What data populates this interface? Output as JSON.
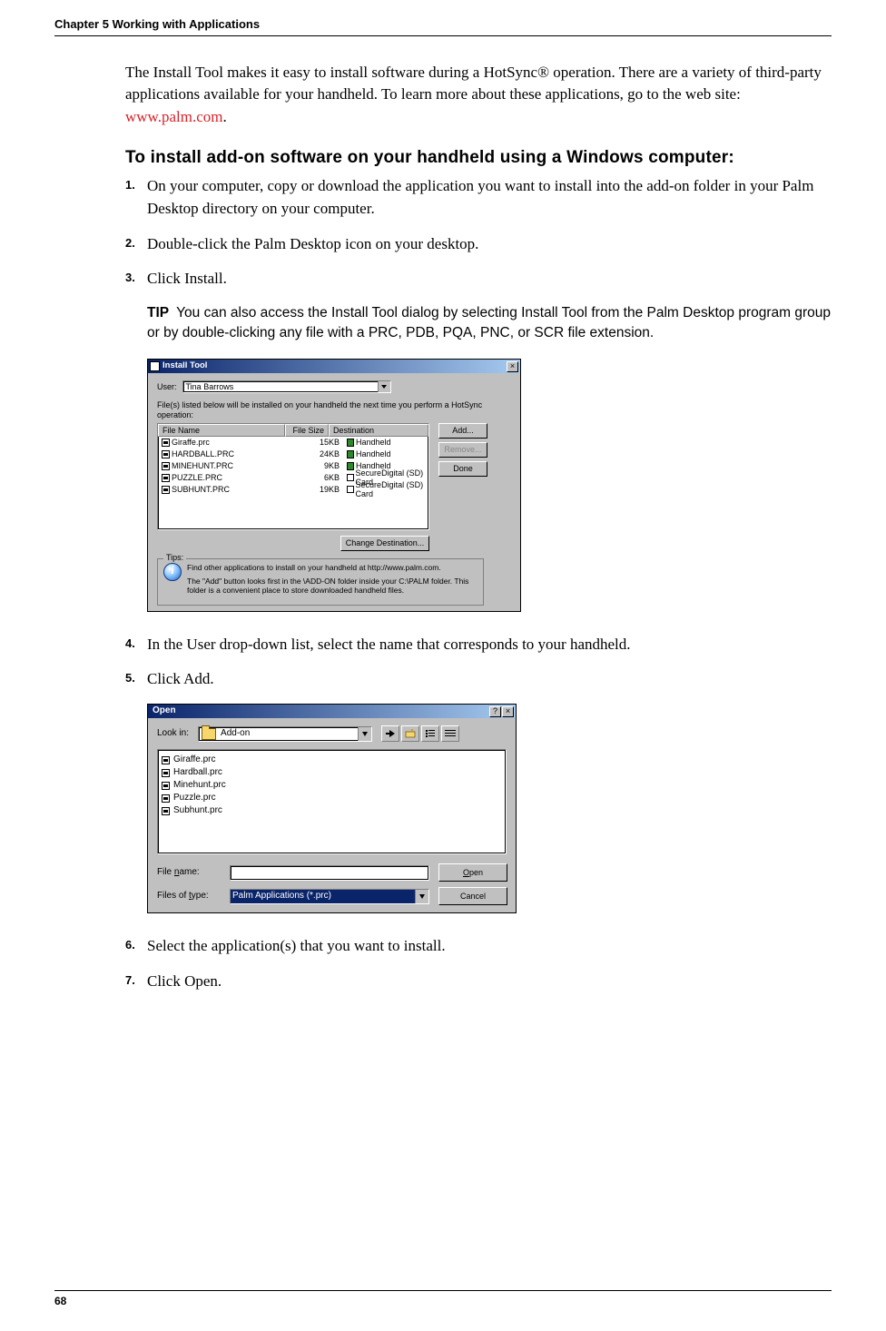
{
  "header": "Chapter 5    Working with Applications",
  "page_number": "68",
  "intro": {
    "text_before_link": "The Install Tool makes it easy to install software during a HotSync® operation. There are a variety of third-party applications available for your handheld. To learn more about these applications, go to the web site: ",
    "link": "www.palm.com",
    "text_after_link": "."
  },
  "heading": "To install add-on software on your handheld using a Windows computer:",
  "steps": {
    "s1": "On your computer, copy or download the application you want to install into the add-on folder in your Palm Desktop directory on your computer.",
    "s2": "Double-click the Palm Desktop icon on your desktop.",
    "s3": "Click Install.",
    "s4": "In the User drop-down list, select the name that corresponds to your handheld.",
    "s5": "Click Add.",
    "s6": "Select the application(s) that you want to install.",
    "s7": "Click Open."
  },
  "tip": {
    "label": "TIP",
    "text": "You can also access the Install Tool dialog by selecting Install Tool from the Palm Desktop program group or by double-clicking any file with a PRC, PDB, PQA, PNC, or SCR file extension."
  },
  "install_dialog": {
    "title": "Install Tool",
    "user_label": "User:",
    "user_value": "Tina Barrows",
    "desc": "File(s) listed below will be installed on your handheld the next time you perform a HotSync operation:",
    "columns": {
      "name": "File Name",
      "size": "File Size",
      "dest": "Destination"
    },
    "files": [
      {
        "name": "Giraffe.prc",
        "size": "15KB",
        "dest": "Handheld"
      },
      {
        "name": "HARDBALL.PRC",
        "size": "24KB",
        "dest": "Handheld"
      },
      {
        "name": "MINEHUNT.PRC",
        "size": "9KB",
        "dest": "Handheld"
      },
      {
        "name": "PUZZLE.PRC",
        "size": "6KB",
        "dest": "SecureDigital (SD) Card"
      },
      {
        "name": "SUBHUNT.PRC",
        "size": "19KB",
        "dest": "SecureDigital (SD) Card"
      }
    ],
    "buttons": {
      "add": "Add...",
      "remove": "Remove...",
      "done": "Done",
      "change_dest": "Change Destination..."
    },
    "tips_legend": "Tips:",
    "tips_line1": "Find other applications to install on your handheld at http://www.palm.com.",
    "tips_line2": "The \"Add\" button looks first in the \\ADD-ON folder inside your C:\\PALM folder. This folder is a convenient place to store downloaded handheld files."
  },
  "open_dialog": {
    "title": "Open",
    "lookin_label": "Look in:",
    "lookin_value": "Add-on",
    "files": [
      "Giraffe.prc",
      "Hardball.prc",
      "Minehunt.prc",
      "Puzzle.prc",
      "Subhunt.prc"
    ],
    "filename_label": "File name:",
    "filename_value": "",
    "filetype_label": "Files of type:",
    "filetype_value": "Palm Applications (*.prc)",
    "open_btn": "Open",
    "cancel_btn": "Cancel"
  }
}
